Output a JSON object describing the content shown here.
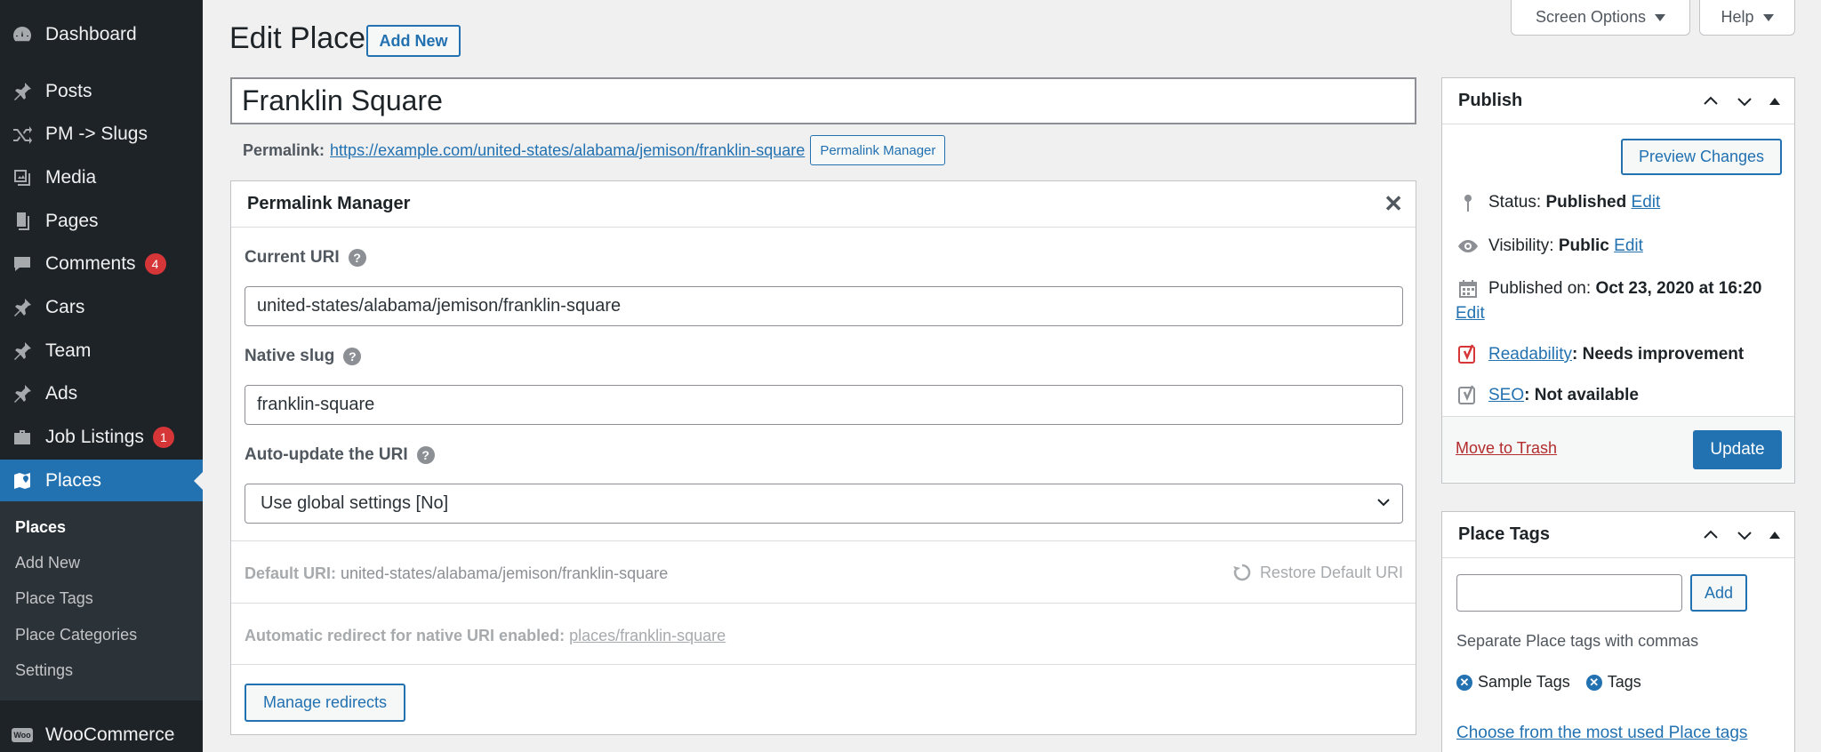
{
  "sidebar": {
    "items": [
      {
        "label": "Dashboard",
        "icon": "dashboard-icon"
      },
      {
        "label": "Posts",
        "icon": "pin-icon"
      },
      {
        "label": "PM -> Slugs",
        "icon": "shuffle-icon"
      },
      {
        "label": "Media",
        "icon": "media-icon"
      },
      {
        "label": "Pages",
        "icon": "pages-icon"
      },
      {
        "label": "Comments",
        "icon": "comment-icon",
        "badge": "4"
      },
      {
        "label": "Cars",
        "icon": "pin-icon"
      },
      {
        "label": "Team",
        "icon": "pin-icon"
      },
      {
        "label": "Ads",
        "icon": "pin-icon"
      },
      {
        "label": "Job Listings",
        "icon": "briefcase-icon",
        "badge": "1"
      },
      {
        "label": "Places",
        "icon": "map-icon"
      }
    ],
    "submenu": [
      "Places",
      "Add New",
      "Place Tags",
      "Place Categories",
      "Settings"
    ],
    "woocommerce": "WooCommerce",
    "woo_icon_text": "Woo"
  },
  "top_buttons": {
    "screen_options": "Screen Options",
    "help": "Help"
  },
  "header": {
    "title": "Edit Place",
    "add_new": "Add New"
  },
  "post": {
    "title": "Franklin Square",
    "permalink_label": "Permalink:",
    "permalink_url": "https://example.com/united-states/alabama/jemison/franklin-square",
    "permalink_button": "Permalink Manager"
  },
  "permalink_manager": {
    "title": "Permalink Manager",
    "current_uri_label": "Current URI",
    "current_uri": "united-states/alabama/jemison/franklin-square",
    "native_slug_label": "Native slug",
    "native_slug": "franklin-square",
    "auto_update_label": "Auto-update the URI",
    "auto_update_value": "Use global settings [No]",
    "default_uri_label": "Default URI:",
    "default_uri": "united-states/alabama/jemison/franklin-square",
    "restore_label": "Restore Default URI",
    "redirect_label": "Automatic redirect for native URI enabled:",
    "redirect_link": "places/franklin-square",
    "manage_redirects": "Manage redirects"
  },
  "publish": {
    "title": "Publish",
    "preview": "Preview Changes",
    "status_label": "Status:",
    "status_value": "Published",
    "visibility_label": "Visibility:",
    "visibility_value": "Public",
    "published_label": "Published on:",
    "published_value": "Oct 23, 2020 at 16:20",
    "edit": "Edit",
    "readability_link": "Readability",
    "readability_value": ": Needs improvement",
    "seo_link": "SEO",
    "seo_value": ": Not available",
    "trash": "Move to Trash",
    "update": "Update"
  },
  "place_tags": {
    "title": "Place Tags",
    "add": "Add",
    "help": "Separate Place tags with commas",
    "tags": [
      "Sample Tags",
      "Tags"
    ],
    "choose": "Choose from the most used Place tags"
  },
  "colors": {
    "accent": "#2271b1",
    "sidebar": "#1d2327",
    "badge": "#d63638",
    "trash": "#b32d2e"
  }
}
